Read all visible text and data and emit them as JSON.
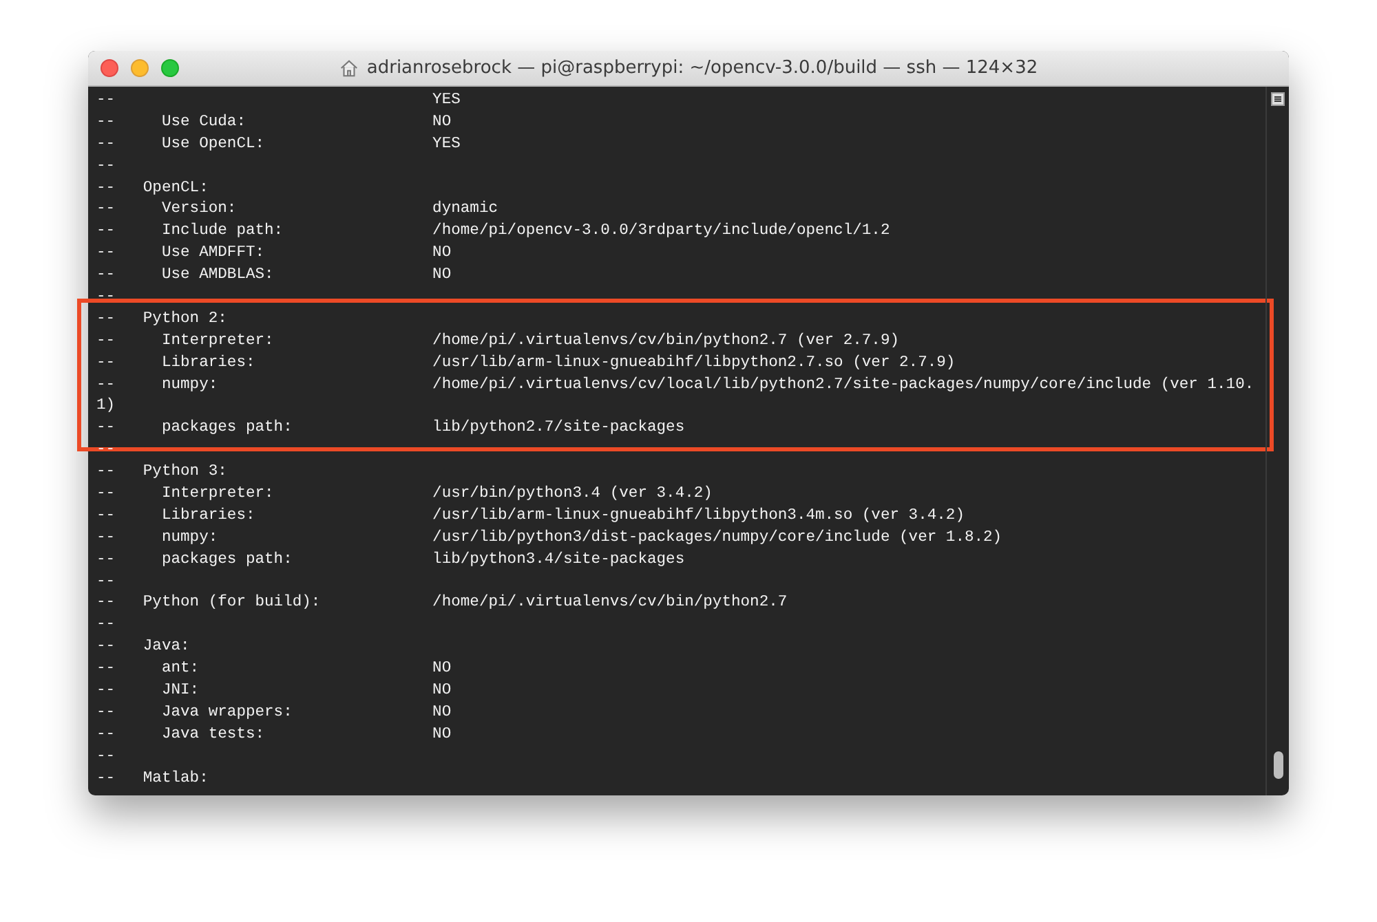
{
  "window": {
    "title": "adrianrosebrock — pi@raspberrypi: ~/opencv-3.0.0/build — ssh — 124×32"
  },
  "terminal": {
    "sections": [
      {
        "highlighted": false,
        "lines": [
          "--                                  YES",
          "--     Use Cuda:                    NO",
          "--     Use OpenCL:                  YES",
          "--",
          "--   OpenCL:",
          "--     Version:                     dynamic",
          "--     Include path:                /home/pi/opencv-3.0.0/3rdparty/include/opencl/1.2",
          "--     Use AMDFFT:                  NO",
          "--     Use AMDBLAS:                 NO",
          "--"
        ]
      },
      {
        "highlighted": true,
        "lines": [
          "--   Python 2:",
          "--     Interpreter:                 /home/pi/.virtualenvs/cv/bin/python2.7 (ver 2.7.9)",
          "--     Libraries:                   /usr/lib/arm-linux-gnueabihf/libpython2.7.so (ver 2.7.9)",
          "--     numpy:                       /home/pi/.virtualenvs/cv/local/lib/python2.7/site-packages/numpy/core/include (ver 1.10.",
          "1)",
          "--     packages path:               lib/python2.7/site-packages"
        ]
      },
      {
        "highlighted": false,
        "lines": [
          "--",
          "--   Python 3:",
          "--     Interpreter:                 /usr/bin/python3.4 (ver 3.4.2)",
          "--     Libraries:                   /usr/lib/arm-linux-gnueabihf/libpython3.4m.so (ver 3.4.2)",
          "--     numpy:                       /usr/lib/python3/dist-packages/numpy/core/include (ver 1.8.2)",
          "--     packages path:               lib/python3.4/site-packages",
          "--",
          "--   Python (for build):            /home/pi/.virtualenvs/cv/bin/python2.7",
          "--",
          "--   Java:",
          "--     ant:                         NO",
          "--     JNI:                         NO",
          "--     Java wrappers:               NO",
          "--     Java tests:                  NO",
          "--",
          "--   Matlab:"
        ]
      }
    ]
  }
}
